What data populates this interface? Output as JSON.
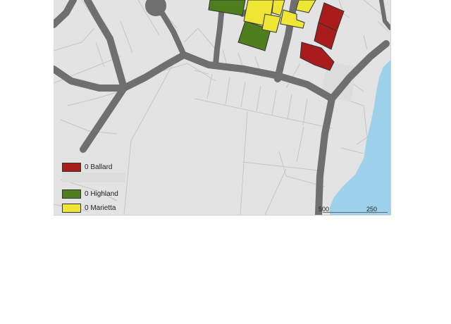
{
  "legend": {
    "items": [
      {
        "label": "0 Ballard",
        "color": "#a81c1c"
      },
      {
        "label": "0 Highland",
        "color": "#4e7e1e"
      },
      {
        "label": "0 Marietta",
        "color": "#eee535"
      }
    ]
  },
  "scale": {
    "left_label": "500",
    "right_label": "250"
  },
  "colors": {
    "land": "#e3e3e3",
    "road": "#6f6f6f",
    "water": "#9dd1ec",
    "parcel_line": "#c2c2c2"
  }
}
